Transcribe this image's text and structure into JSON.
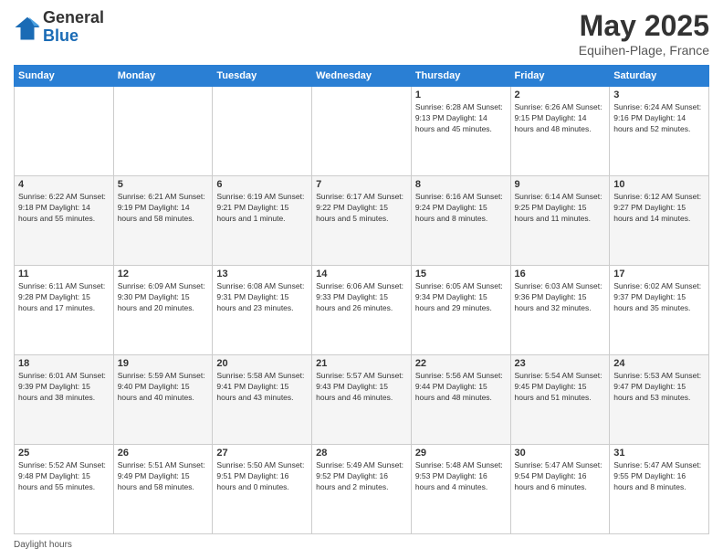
{
  "header": {
    "logo_general": "General",
    "logo_blue": "Blue",
    "month_title": "May 2025",
    "location": "Equihen-Plage, France"
  },
  "footer": {
    "label": "Daylight hours"
  },
  "days_of_week": [
    "Sunday",
    "Monday",
    "Tuesday",
    "Wednesday",
    "Thursday",
    "Friday",
    "Saturday"
  ],
  "weeks": [
    [
      {
        "day": "",
        "info": ""
      },
      {
        "day": "",
        "info": ""
      },
      {
        "day": "",
        "info": ""
      },
      {
        "day": "",
        "info": ""
      },
      {
        "day": "1",
        "info": "Sunrise: 6:28 AM\nSunset: 9:13 PM\nDaylight: 14 hours and 45 minutes."
      },
      {
        "day": "2",
        "info": "Sunrise: 6:26 AM\nSunset: 9:15 PM\nDaylight: 14 hours and 48 minutes."
      },
      {
        "day": "3",
        "info": "Sunrise: 6:24 AM\nSunset: 9:16 PM\nDaylight: 14 hours and 52 minutes."
      }
    ],
    [
      {
        "day": "4",
        "info": "Sunrise: 6:22 AM\nSunset: 9:18 PM\nDaylight: 14 hours and 55 minutes."
      },
      {
        "day": "5",
        "info": "Sunrise: 6:21 AM\nSunset: 9:19 PM\nDaylight: 14 hours and 58 minutes."
      },
      {
        "day": "6",
        "info": "Sunrise: 6:19 AM\nSunset: 9:21 PM\nDaylight: 15 hours and 1 minute."
      },
      {
        "day": "7",
        "info": "Sunrise: 6:17 AM\nSunset: 9:22 PM\nDaylight: 15 hours and 5 minutes."
      },
      {
        "day": "8",
        "info": "Sunrise: 6:16 AM\nSunset: 9:24 PM\nDaylight: 15 hours and 8 minutes."
      },
      {
        "day": "9",
        "info": "Sunrise: 6:14 AM\nSunset: 9:25 PM\nDaylight: 15 hours and 11 minutes."
      },
      {
        "day": "10",
        "info": "Sunrise: 6:12 AM\nSunset: 9:27 PM\nDaylight: 15 hours and 14 minutes."
      }
    ],
    [
      {
        "day": "11",
        "info": "Sunrise: 6:11 AM\nSunset: 9:28 PM\nDaylight: 15 hours and 17 minutes."
      },
      {
        "day": "12",
        "info": "Sunrise: 6:09 AM\nSunset: 9:30 PM\nDaylight: 15 hours and 20 minutes."
      },
      {
        "day": "13",
        "info": "Sunrise: 6:08 AM\nSunset: 9:31 PM\nDaylight: 15 hours and 23 minutes."
      },
      {
        "day": "14",
        "info": "Sunrise: 6:06 AM\nSunset: 9:33 PM\nDaylight: 15 hours and 26 minutes."
      },
      {
        "day": "15",
        "info": "Sunrise: 6:05 AM\nSunset: 9:34 PM\nDaylight: 15 hours and 29 minutes."
      },
      {
        "day": "16",
        "info": "Sunrise: 6:03 AM\nSunset: 9:36 PM\nDaylight: 15 hours and 32 minutes."
      },
      {
        "day": "17",
        "info": "Sunrise: 6:02 AM\nSunset: 9:37 PM\nDaylight: 15 hours and 35 minutes."
      }
    ],
    [
      {
        "day": "18",
        "info": "Sunrise: 6:01 AM\nSunset: 9:39 PM\nDaylight: 15 hours and 38 minutes."
      },
      {
        "day": "19",
        "info": "Sunrise: 5:59 AM\nSunset: 9:40 PM\nDaylight: 15 hours and 40 minutes."
      },
      {
        "day": "20",
        "info": "Sunrise: 5:58 AM\nSunset: 9:41 PM\nDaylight: 15 hours and 43 minutes."
      },
      {
        "day": "21",
        "info": "Sunrise: 5:57 AM\nSunset: 9:43 PM\nDaylight: 15 hours and 46 minutes."
      },
      {
        "day": "22",
        "info": "Sunrise: 5:56 AM\nSunset: 9:44 PM\nDaylight: 15 hours and 48 minutes."
      },
      {
        "day": "23",
        "info": "Sunrise: 5:54 AM\nSunset: 9:45 PM\nDaylight: 15 hours and 51 minutes."
      },
      {
        "day": "24",
        "info": "Sunrise: 5:53 AM\nSunset: 9:47 PM\nDaylight: 15 hours and 53 minutes."
      }
    ],
    [
      {
        "day": "25",
        "info": "Sunrise: 5:52 AM\nSunset: 9:48 PM\nDaylight: 15 hours and 55 minutes."
      },
      {
        "day": "26",
        "info": "Sunrise: 5:51 AM\nSunset: 9:49 PM\nDaylight: 15 hours and 58 minutes."
      },
      {
        "day": "27",
        "info": "Sunrise: 5:50 AM\nSunset: 9:51 PM\nDaylight: 16 hours and 0 minutes."
      },
      {
        "day": "28",
        "info": "Sunrise: 5:49 AM\nSunset: 9:52 PM\nDaylight: 16 hours and 2 minutes."
      },
      {
        "day": "29",
        "info": "Sunrise: 5:48 AM\nSunset: 9:53 PM\nDaylight: 16 hours and 4 minutes."
      },
      {
        "day": "30",
        "info": "Sunrise: 5:47 AM\nSunset: 9:54 PM\nDaylight: 16 hours and 6 minutes."
      },
      {
        "day": "31",
        "info": "Sunrise: 5:47 AM\nSunset: 9:55 PM\nDaylight: 16 hours and 8 minutes."
      }
    ]
  ]
}
